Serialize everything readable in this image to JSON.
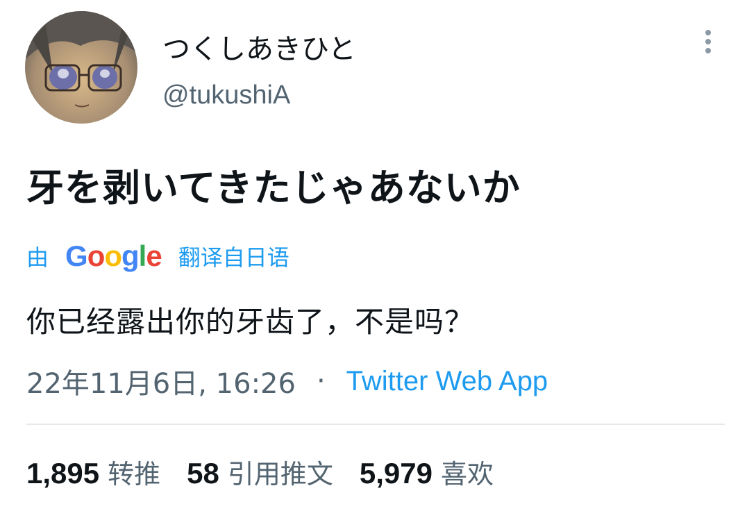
{
  "user": {
    "display_name": "つくしあきひと",
    "handle": "@tukushiA",
    "avatar_icon": "avatar-image"
  },
  "menu": {
    "icon": "more-vertical-icon"
  },
  "tweet": {
    "text": "牙を剥いてきたじゃあないか"
  },
  "translation": {
    "by_label": "由",
    "google_letters": [
      {
        "ch": "G",
        "color": "#4285F4"
      },
      {
        "ch": "o",
        "color": "#EA4335"
      },
      {
        "ch": "o",
        "color": "#FBBC05"
      },
      {
        "ch": "g",
        "color": "#4285F4"
      },
      {
        "ch": "l",
        "color": "#34A853"
      },
      {
        "ch": "e",
        "color": "#EA4335"
      }
    ],
    "from_label": "翻译自日语",
    "text": "你已经露出你的牙齿了，不是吗？"
  },
  "meta": {
    "timestamp": "22年11月6日, 16:26",
    "separator": "·",
    "source": "Twitter Web App"
  },
  "stats": {
    "retweets_count": "1,895",
    "retweets_label": "转推",
    "quotes_count": "58",
    "quotes_label": "引用推文",
    "likes_count": "5,979",
    "likes_label": "喜欢"
  },
  "colors": {
    "accent": "#1d9bf0",
    "secondary_text": "#536471",
    "primary_text": "#0f1419",
    "divider": "#e6e9ec"
  }
}
